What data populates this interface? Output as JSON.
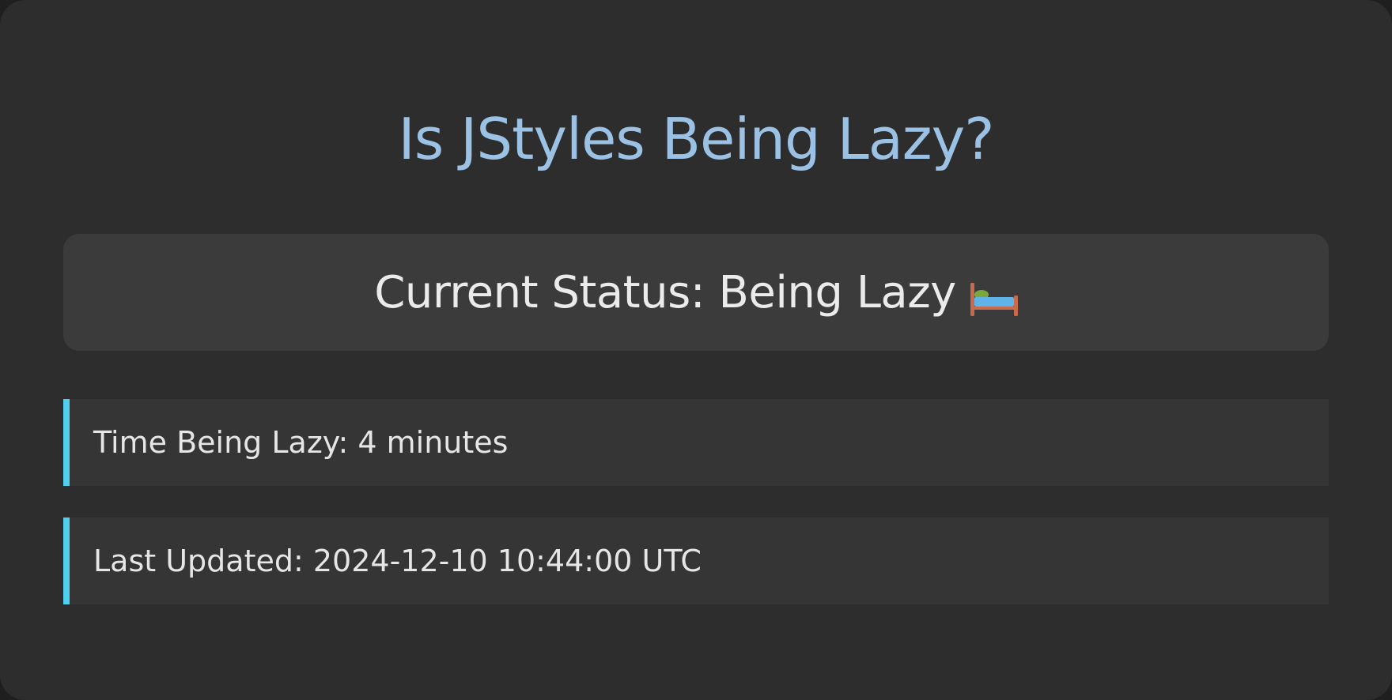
{
  "page": {
    "title": "Is JStyles Being Lazy?"
  },
  "status": {
    "text": "Current Status: Being Lazy",
    "icon": "bed-icon"
  },
  "info": {
    "time_being_lazy": "Time Being Lazy: 4 minutes",
    "last_updated": "Last Updated: 2024-12-10 10:44:00 UTC"
  },
  "colors": {
    "background": "#2d2d2d",
    "title": "#9bc2e4",
    "status_box": "#3b3b3b",
    "info_row": "#353535",
    "accent": "#4fd0ee",
    "text": "#e6e6e6"
  }
}
